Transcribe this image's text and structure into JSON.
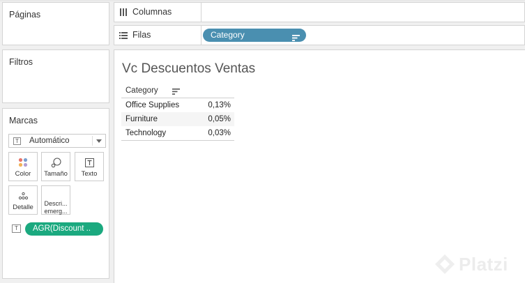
{
  "left_panel": {
    "pages_title": "Páginas",
    "filters_title": "Filtros",
    "marks_title": "Marcas"
  },
  "marks": {
    "type_select_value": "Automático",
    "buttons": [
      {
        "label": "Color",
        "icon": "color-dots-icon"
      },
      {
        "label": "Tamaño",
        "icon": "size-icon"
      },
      {
        "label": "Texto",
        "icon": "text-icon"
      },
      {
        "label": "Detalle",
        "icon": "detail-dots-icon"
      },
      {
        "label_line1": "Descri...",
        "label_line2": "emerg...",
        "icon": "tooltip-icon"
      }
    ],
    "text_pill": "AGR(Discount ..",
    "color_dots": [
      "#e8746b",
      "#7a9fcf",
      "#f2b259",
      "#b39ed3"
    ]
  },
  "shelves": {
    "columns_label": "Columnas",
    "rows_label": "Filas",
    "rows_pill": "Category"
  },
  "view": {
    "title": "Vc Descuentos Ventas",
    "header": "Category",
    "rows": [
      {
        "category": "Office Supplies",
        "value": "0,13%"
      },
      {
        "category": "Furniture",
        "value": "0,05%"
      },
      {
        "category": "Technology",
        "value": "0,03%"
      }
    ]
  },
  "watermark": "Platzi",
  "colors": {
    "rows_pill": "#4a8fb0",
    "measure_pill": "#1ba97f"
  }
}
